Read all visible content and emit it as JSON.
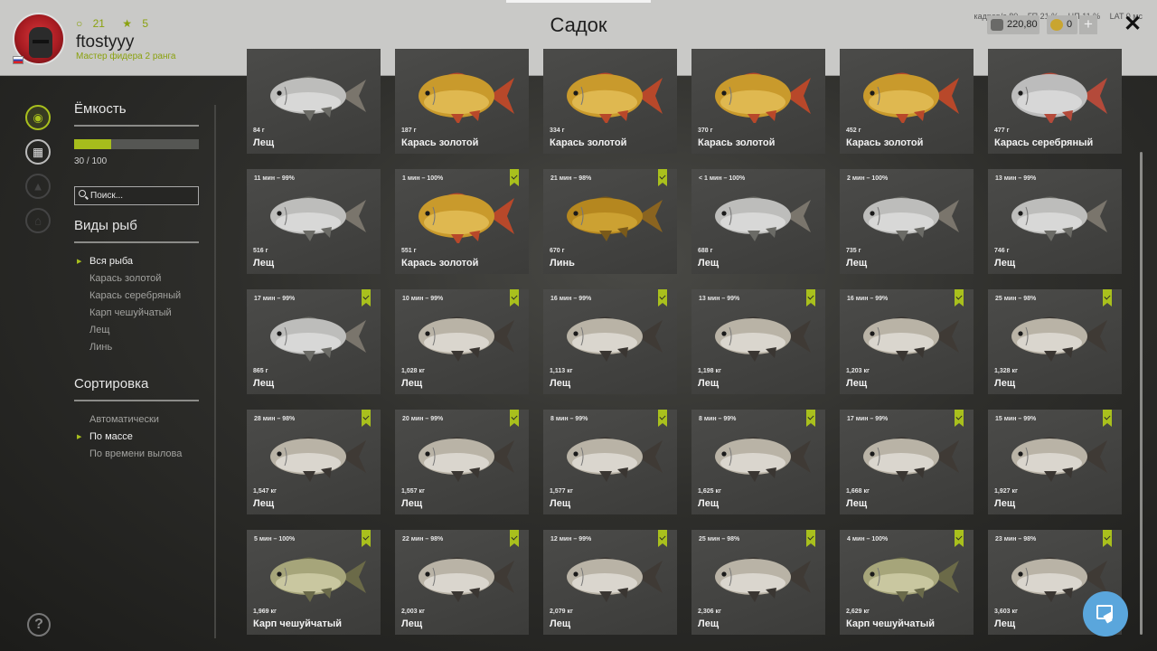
{
  "player": {
    "level": "21",
    "stars": "5",
    "name": "ftostyyy",
    "rank": "Мастер фидера 2 ранга"
  },
  "window_title": "Садок",
  "perf": {
    "fps": "кадров/с 80",
    "gpu": "ГП 21 %",
    "cpu": "ЦП 11 %",
    "lat": "LAT 0 мс"
  },
  "currency": {
    "silver": "220,80",
    "gold": "0"
  },
  "colors": {
    "accent": "#a9c01d",
    "fab": "#5aa6dc"
  },
  "capacity": {
    "label": "Ёмкость",
    "text": "30 / 100",
    "fraction": 0.3
  },
  "search": {
    "placeholder": "Поиск..."
  },
  "species": {
    "header": "Виды рыб",
    "items": [
      "Вся рыба",
      "Карась золотой",
      "Карась серебряный",
      "Карп чешуйчатый",
      "Лещ",
      "Линь"
    ],
    "selected": 0
  },
  "sort": {
    "header": "Сортировка",
    "items": [
      "Автоматически",
      "По массе",
      "По времени вылова"
    ],
    "selected": 1
  },
  "fish_cards": [
    {
      "meta": "",
      "weight": "84 г",
      "name": "Лещ",
      "kind": "bream-silver",
      "badge": false
    },
    {
      "meta": "",
      "weight": "187 г",
      "name": "Карась золотой",
      "kind": "crucian",
      "badge": false
    },
    {
      "meta": "",
      "weight": "334 г",
      "name": "Карась золотой",
      "kind": "crucian",
      "badge": false
    },
    {
      "meta": "",
      "weight": "370 г",
      "name": "Карась золотой",
      "kind": "crucian",
      "badge": false
    },
    {
      "meta": "",
      "weight": "452 г",
      "name": "Карась золотой",
      "kind": "crucian",
      "badge": false
    },
    {
      "meta": "",
      "weight": "477 г",
      "name": "Карась серебряный",
      "kind": "silver-crucian",
      "badge": false
    },
    {
      "meta": "11 мин – 99%",
      "weight": "516 г",
      "name": "Лещ",
      "kind": "bream-silver",
      "badge": false
    },
    {
      "meta": "1 мин – 100%",
      "weight": "551 г",
      "name": "Карась золотой",
      "kind": "crucian",
      "badge": true
    },
    {
      "meta": "21 мин – 98%",
      "weight": "670 г",
      "name": "Линь",
      "kind": "tench",
      "badge": true
    },
    {
      "meta": "< 1 мин – 100%",
      "weight": "688 г",
      "name": "Лещ",
      "kind": "bream-silver",
      "badge": false
    },
    {
      "meta": "2 мин – 100%",
      "weight": "735 г",
      "name": "Лещ",
      "kind": "bream-silver",
      "badge": false
    },
    {
      "meta": "13 мин – 99%",
      "weight": "746 г",
      "name": "Лещ",
      "kind": "bream-silver",
      "badge": false
    },
    {
      "meta": "17 мин – 99%",
      "weight": "865 г",
      "name": "Лещ",
      "kind": "bream-silver",
      "badge": true
    },
    {
      "meta": "10 мин – 99%",
      "weight": "1,028 кг",
      "name": "Лещ",
      "kind": "bream",
      "badge": true
    },
    {
      "meta": "16 мин – 99%",
      "weight": "1,113 кг",
      "name": "Лещ",
      "kind": "bream",
      "badge": true
    },
    {
      "meta": "13 мин – 99%",
      "weight": "1,198 кг",
      "name": "Лещ",
      "kind": "bream",
      "badge": true
    },
    {
      "meta": "16 мин – 99%",
      "weight": "1,203 кг",
      "name": "Лещ",
      "kind": "bream",
      "badge": true
    },
    {
      "meta": "25 мин – 98%",
      "weight": "1,328 кг",
      "name": "Лещ",
      "kind": "bream",
      "badge": true
    },
    {
      "meta": "28 мин – 98%",
      "weight": "1,547 кг",
      "name": "Лещ",
      "kind": "bream",
      "badge": true
    },
    {
      "meta": "20 мин – 99%",
      "weight": "1,557 кг",
      "name": "Лещ",
      "kind": "bream",
      "badge": true
    },
    {
      "meta": "8 мин – 99%",
      "weight": "1,577 кг",
      "name": "Лещ",
      "kind": "bream",
      "badge": true
    },
    {
      "meta": "8 мин – 99%",
      "weight": "1,625 кг",
      "name": "Лещ",
      "kind": "bream",
      "badge": true
    },
    {
      "meta": "17 мин – 99%",
      "weight": "1,668 кг",
      "name": "Лещ",
      "kind": "bream",
      "badge": true
    },
    {
      "meta": "15 мин – 99%",
      "weight": "1,927 кг",
      "name": "Лещ",
      "kind": "bream",
      "badge": true
    },
    {
      "meta": "5 мин – 100%",
      "weight": "1,969 кг",
      "name": "Карп чешуйчатый",
      "kind": "carp",
      "badge": true
    },
    {
      "meta": "22 мин – 98%",
      "weight": "2,003 кг",
      "name": "Лещ",
      "kind": "bream",
      "badge": true
    },
    {
      "meta": "12 мин – 99%",
      "weight": "2,079 кг",
      "name": "Лещ",
      "kind": "bream",
      "badge": true
    },
    {
      "meta": "25 мин – 98%",
      "weight": "2,306 кг",
      "name": "Лещ",
      "kind": "bream",
      "badge": true
    },
    {
      "meta": "4 мин – 100%",
      "weight": "2,629 кг",
      "name": "Карп чешуйчатый",
      "kind": "carp",
      "badge": true
    },
    {
      "meta": "23 мин – 98%",
      "weight": "3,603 кг",
      "name": "Лещ",
      "kind": "bream",
      "badge": true
    }
  ]
}
